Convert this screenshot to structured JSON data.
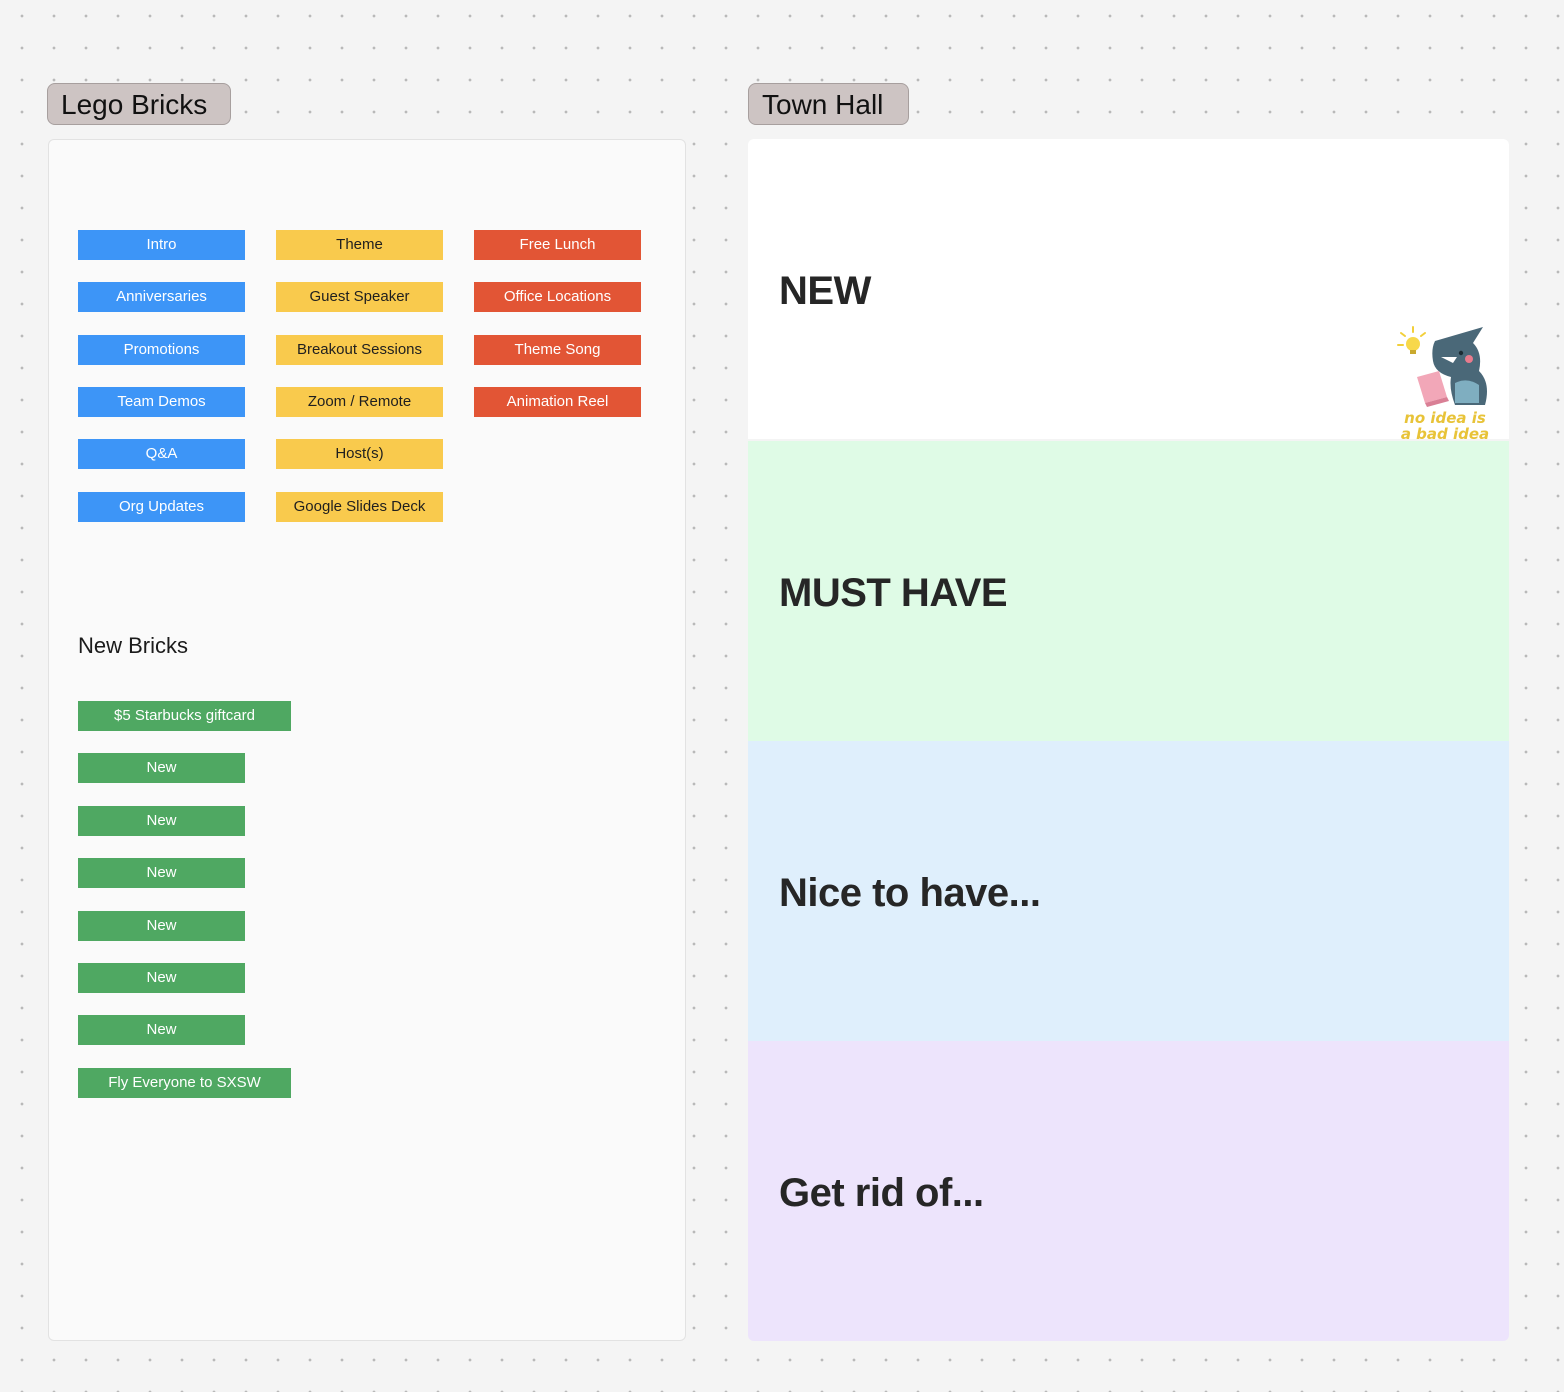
{
  "lego_bricks": {
    "title": "Lego Bricks",
    "blue": [
      "Intro",
      "Anniversaries",
      "Promotions",
      "Team Demos",
      "Q&A",
      "Org Updates"
    ],
    "yellow": [
      "Theme",
      "Guest Speaker",
      "Breakout Sessions",
      "Zoom / Remote",
      "Host(s)",
      "Google Slides Deck"
    ],
    "red": [
      "Free Lunch",
      "Office Locations",
      "Theme Song",
      "Animation Reel"
    ],
    "new_bricks_heading": "New Bricks",
    "green": [
      "$5 Starbucks giftcard",
      "New",
      "New",
      "New",
      "New",
      "New",
      "New",
      "Fly Everyone to SXSW"
    ]
  },
  "town_hall": {
    "title": "Town Hall",
    "zones": [
      "NEW",
      "MUST HAVE",
      "Nice to have...",
      "Get rid of..."
    ],
    "sticker_text": [
      "no idea is",
      "a bad idea"
    ]
  },
  "colors": {
    "blue": "#3d95f7",
    "yellow": "#f9ca4d",
    "red": "#e25535",
    "green": "#4fa862",
    "zone_new": "#ffffff",
    "zone_must_have": "#dffbe6",
    "zone_nice": "#dfeffc",
    "zone_get_rid": "#ede4fc"
  }
}
